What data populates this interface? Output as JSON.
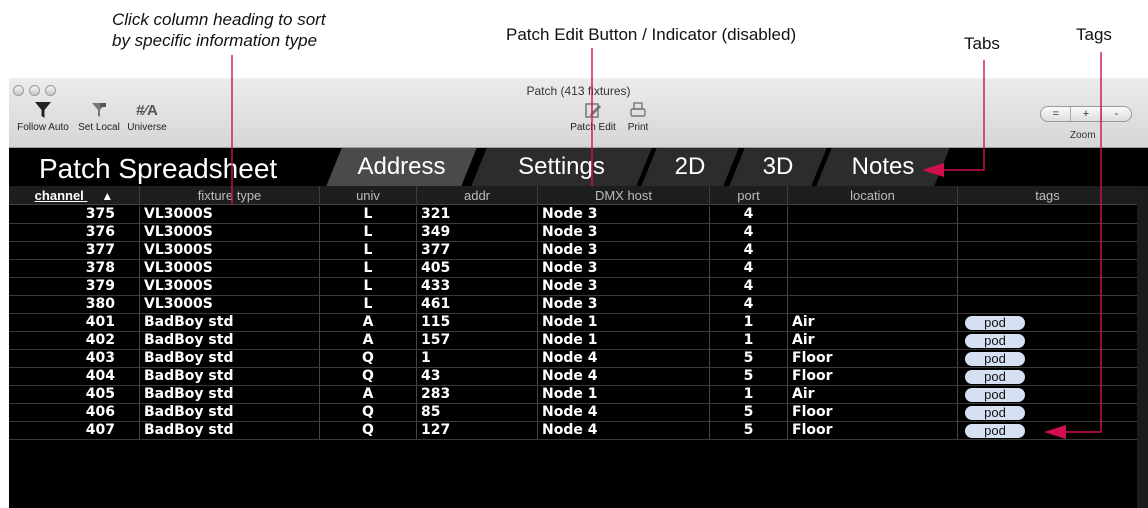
{
  "callouts": {
    "sort_hint_line1": "Click column heading to sort",
    "sort_hint_line2": "by specific information type",
    "patch_edit": "Patch Edit Button / Indicator (disabled)",
    "tabs": "Tabs",
    "tags": "Tags"
  },
  "window": {
    "title": "Patch (413 fixtures)"
  },
  "toolbar": {
    "follow_auto": "Follow Auto",
    "set_local": "Set Local",
    "universe": "Universe",
    "universe_glyph": "#⁄A",
    "patch_edit": "Patch Edit",
    "print": "Print",
    "zoom_label": "Zoom",
    "zoom_buttons": [
      "=",
      "+",
      "-"
    ]
  },
  "sheet_title": "Patch Spreadsheet",
  "tabs": [
    {
      "label": "Address",
      "active": true
    },
    {
      "label": "Settings",
      "active": false
    },
    {
      "label": "2D",
      "active": false
    },
    {
      "label": "3D",
      "active": false
    },
    {
      "label": "Notes",
      "active": false
    }
  ],
  "columns": [
    "channel",
    "fixture type",
    "univ",
    "addr",
    "DMX host",
    "port",
    "location",
    "tags"
  ],
  "sort_indicator": "▲",
  "rows": [
    {
      "channel": "375",
      "fixture": "VL3000S",
      "univ": "L",
      "addr": "321",
      "host": "Node 3",
      "port": "4",
      "location": "",
      "tag": ""
    },
    {
      "channel": "376",
      "fixture": "VL3000S",
      "univ": "L",
      "addr": "349",
      "host": "Node 3",
      "port": "4",
      "location": "",
      "tag": ""
    },
    {
      "channel": "377",
      "fixture": "VL3000S",
      "univ": "L",
      "addr": "377",
      "host": "Node 3",
      "port": "4",
      "location": "",
      "tag": ""
    },
    {
      "channel": "378",
      "fixture": "VL3000S",
      "univ": "L",
      "addr": "405",
      "host": "Node 3",
      "port": "4",
      "location": "",
      "tag": ""
    },
    {
      "channel": "379",
      "fixture": "VL3000S",
      "univ": "L",
      "addr": "433",
      "host": "Node 3",
      "port": "4",
      "location": "",
      "tag": ""
    },
    {
      "channel": "380",
      "fixture": "VL3000S",
      "univ": "L",
      "addr": "461",
      "host": "Node 3",
      "port": "4",
      "location": "",
      "tag": ""
    },
    {
      "channel": "401",
      "fixture": "BadBoy std",
      "univ": "A",
      "addr": "115",
      "host": "Node 1",
      "port": "1",
      "location": "Air",
      "tag": "pod"
    },
    {
      "channel": "402",
      "fixture": "BadBoy std",
      "univ": "A",
      "addr": "157",
      "host": "Node 1",
      "port": "1",
      "location": "Air",
      "tag": "pod"
    },
    {
      "channel": "403",
      "fixture": "BadBoy std",
      "univ": "Q",
      "addr": "1",
      "host": "Node 4",
      "port": "5",
      "location": "Floor",
      "tag": "pod"
    },
    {
      "channel": "404",
      "fixture": "BadBoy std",
      "univ": "Q",
      "addr": "43",
      "host": "Node 4",
      "port": "5",
      "location": "Floor",
      "tag": "pod"
    },
    {
      "channel": "405",
      "fixture": "BadBoy std",
      "univ": "A",
      "addr": "283",
      "host": "Node 1",
      "port": "1",
      "location": "Air",
      "tag": "pod"
    },
    {
      "channel": "406",
      "fixture": "BadBoy std",
      "univ": "Q",
      "addr": "85",
      "host": "Node 4",
      "port": "5",
      "location": "Floor",
      "tag": "pod"
    },
    {
      "channel": "407",
      "fixture": "BadBoy std",
      "univ": "Q",
      "addr": "127",
      "host": "Node 4",
      "port": "5",
      "location": "Floor",
      "tag": "pod"
    }
  ],
  "colors": {
    "annotation_arrow": "#d0104c",
    "tag_pill": "#d7dff3"
  }
}
